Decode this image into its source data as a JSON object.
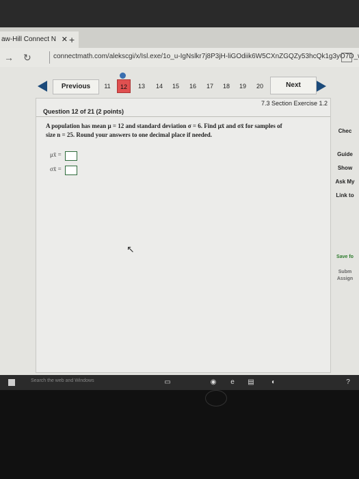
{
  "browser": {
    "tab_title": "aw-Hill Connect Ν",
    "tab_close": "✕",
    "new_tab": "+",
    "url": "connectmath.com/alekscgi/x/Isl.exe/1o_u-IgNslkr7j8P3jH-liGOdiik6W5CXnZGQZy53hcQk1g3yO7D_w"
  },
  "question_nav": {
    "previous_label": "Previous",
    "next_label": "Next",
    "numbers": [
      "11",
      "12",
      "13",
      "14",
      "15",
      "16",
      "17",
      "18",
      "19",
      "20"
    ],
    "active": "12"
  },
  "question": {
    "title": "Question 12 of 21 (2 points)",
    "section": "7.3 Section Exercise 1.2",
    "prompt_line1": "A population has mean μ = 12 and standard deviation σ = 6. Find μx̄ and σx̄ for samples of",
    "prompt_line2": "size n = 25. Round your answers to one decimal place if needed.",
    "answers": [
      {
        "label": "μx̄ =",
        "value": ""
      },
      {
        "label": "σx̄ =",
        "value": ""
      }
    ]
  },
  "sidebar": {
    "check_label": "Chec",
    "guide_label": "Guide",
    "show_label": "Show",
    "ask_label": "Ask My",
    "link_label": "Link to",
    "save_label": "Save fo",
    "submit_label": "Subm",
    "assign_label": "Assign"
  },
  "taskbar": {
    "search_placeholder": "Search the web and Windows"
  },
  "colors": {
    "active_question": "#e05050",
    "nav_arrow": "#1b4a7a",
    "green_text": "#2a7a2a"
  }
}
